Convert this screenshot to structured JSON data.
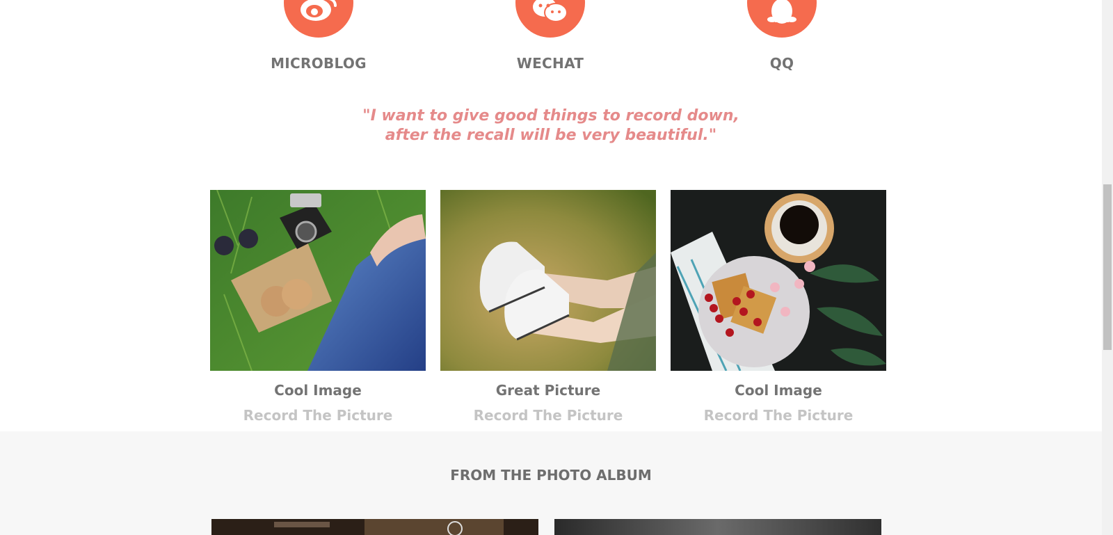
{
  "social": {
    "items": [
      {
        "label": "MICROBLOG",
        "icon": "weibo-icon"
      },
      {
        "label": "WECHAT",
        "icon": "wechat-icon"
      },
      {
        "label": "QQ",
        "icon": "qq-penguin-icon"
      }
    ],
    "accent_color": "#f56b4e"
  },
  "quote": {
    "line1": "\"I want to give good things to record down,",
    "line2": "after the recall will be very beautiful.\""
  },
  "gallery": {
    "cards": [
      {
        "title": "Cool Image",
        "subtitle": "Record The Picture"
      },
      {
        "title": "Great Picture",
        "subtitle": "Record The Picture"
      },
      {
        "title": "Cool Image",
        "subtitle": "Record The Picture"
      }
    ]
  },
  "album": {
    "title": "FROM THE PHOTO ALBUM"
  }
}
